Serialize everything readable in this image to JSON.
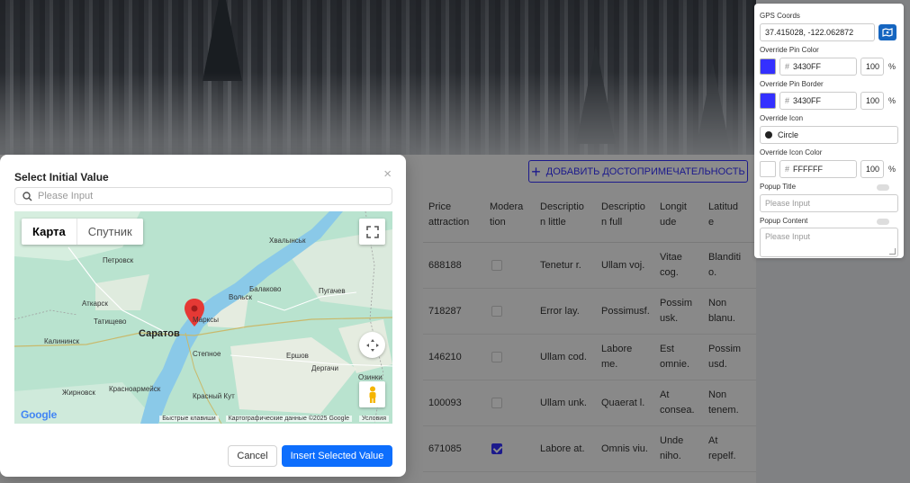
{
  "page": {
    "add_button_label": "ДОБАВИТЬ ДОСТОПРИМЕЧАТЕЛЬНОСТЬ",
    "table": {
      "headers": [
        "Price attraction",
        "Moderation",
        "Description little",
        "Description full",
        "Longitude",
        "Latitude"
      ],
      "header_display": [
        "Price\nattraction",
        "Modera\ntion",
        "Descriptio\nn little",
        "Descriptio\nn full",
        "Longit\nude",
        "Latitud\ne"
      ],
      "rows": [
        {
          "price": "688188",
          "moderation": false,
          "desc_little": "Tenetur r.",
          "desc_full": "Ullam voj.",
          "longitude": "Vitae\ncog.",
          "latitude": "Blanditi\no."
        },
        {
          "price": "718287",
          "moderation": false,
          "desc_little": "Error lay.",
          "desc_full": "Possimusf.",
          "longitude": "Possim\nusk.",
          "latitude": "Non\nblanu."
        },
        {
          "price": "146210",
          "moderation": false,
          "desc_little": "Ullam cod.",
          "desc_full": "Labore\nme.",
          "longitude": "Est\nomnie.",
          "latitude": "Possim\nusd."
        },
        {
          "price": "100093",
          "moderation": false,
          "desc_little": "Ullam unk.",
          "desc_full": "Quaerat l.",
          "longitude": "At\nconsea.",
          "latitude": "Non\ntenem."
        },
        {
          "price": "671085",
          "moderation": true,
          "desc_little": "Labore at.",
          "desc_full": "Omnis viu.",
          "longitude": "Unde\nniho.",
          "latitude": "At\nrepelf."
        }
      ]
    }
  },
  "settings": {
    "gps_label": "GPS Coords",
    "gps_value": "37.415028, -122.062872",
    "pin_color_label": "Override Pin Color",
    "pin_color_hex": "3430FF",
    "pin_color_opacity": "100",
    "pin_border_label": "Override Pin Border",
    "pin_border_hex": "3430FF",
    "pin_border_opacity": "100",
    "icon_label": "Override Icon",
    "icon_value": "Circle",
    "icon_color_label": "Override Icon Color",
    "icon_color_hex": "FFFFFF",
    "icon_color_opacity": "100",
    "percent": "%",
    "hash": "#",
    "popup_title_label": "Popup Title",
    "popup_title_placeholder": "Please Input",
    "popup_content_label": "Popup Content",
    "popup_content_placeholder": "Please Input",
    "pin_swatch_color": "#3430ff",
    "icon_swatch_color": "#ffffff"
  },
  "modal": {
    "title": "Select Initial Value",
    "close_glyph": "×",
    "search_placeholder": "Please Input",
    "map": {
      "type_map": "Карта",
      "type_satellite": "Спутник",
      "cities": [
        "Хвалынськ",
        "Петровск",
        "Аткарск",
        "Татищево",
        "Калининск",
        "Саратов",
        "Марксы",
        "Вольск",
        "Балаково",
        "Пугачев",
        "Степное",
        "Ершов",
        "Дергачи",
        "Озинки",
        "Красноармейск",
        "Жирновск",
        "Красный Кут"
      ],
      "footer_shortcuts": "Быстрые клавиши",
      "footer_data": "Картографические данные ©2025 Google",
      "footer_terms": "Условия",
      "google_logo": "Google"
    },
    "cancel_label": "Cancel",
    "insert_label": "Insert Selected Value"
  },
  "colors": {
    "accent": "#3430ff",
    "primary_button": "#0d6efd",
    "pin_red": "#e53935"
  }
}
